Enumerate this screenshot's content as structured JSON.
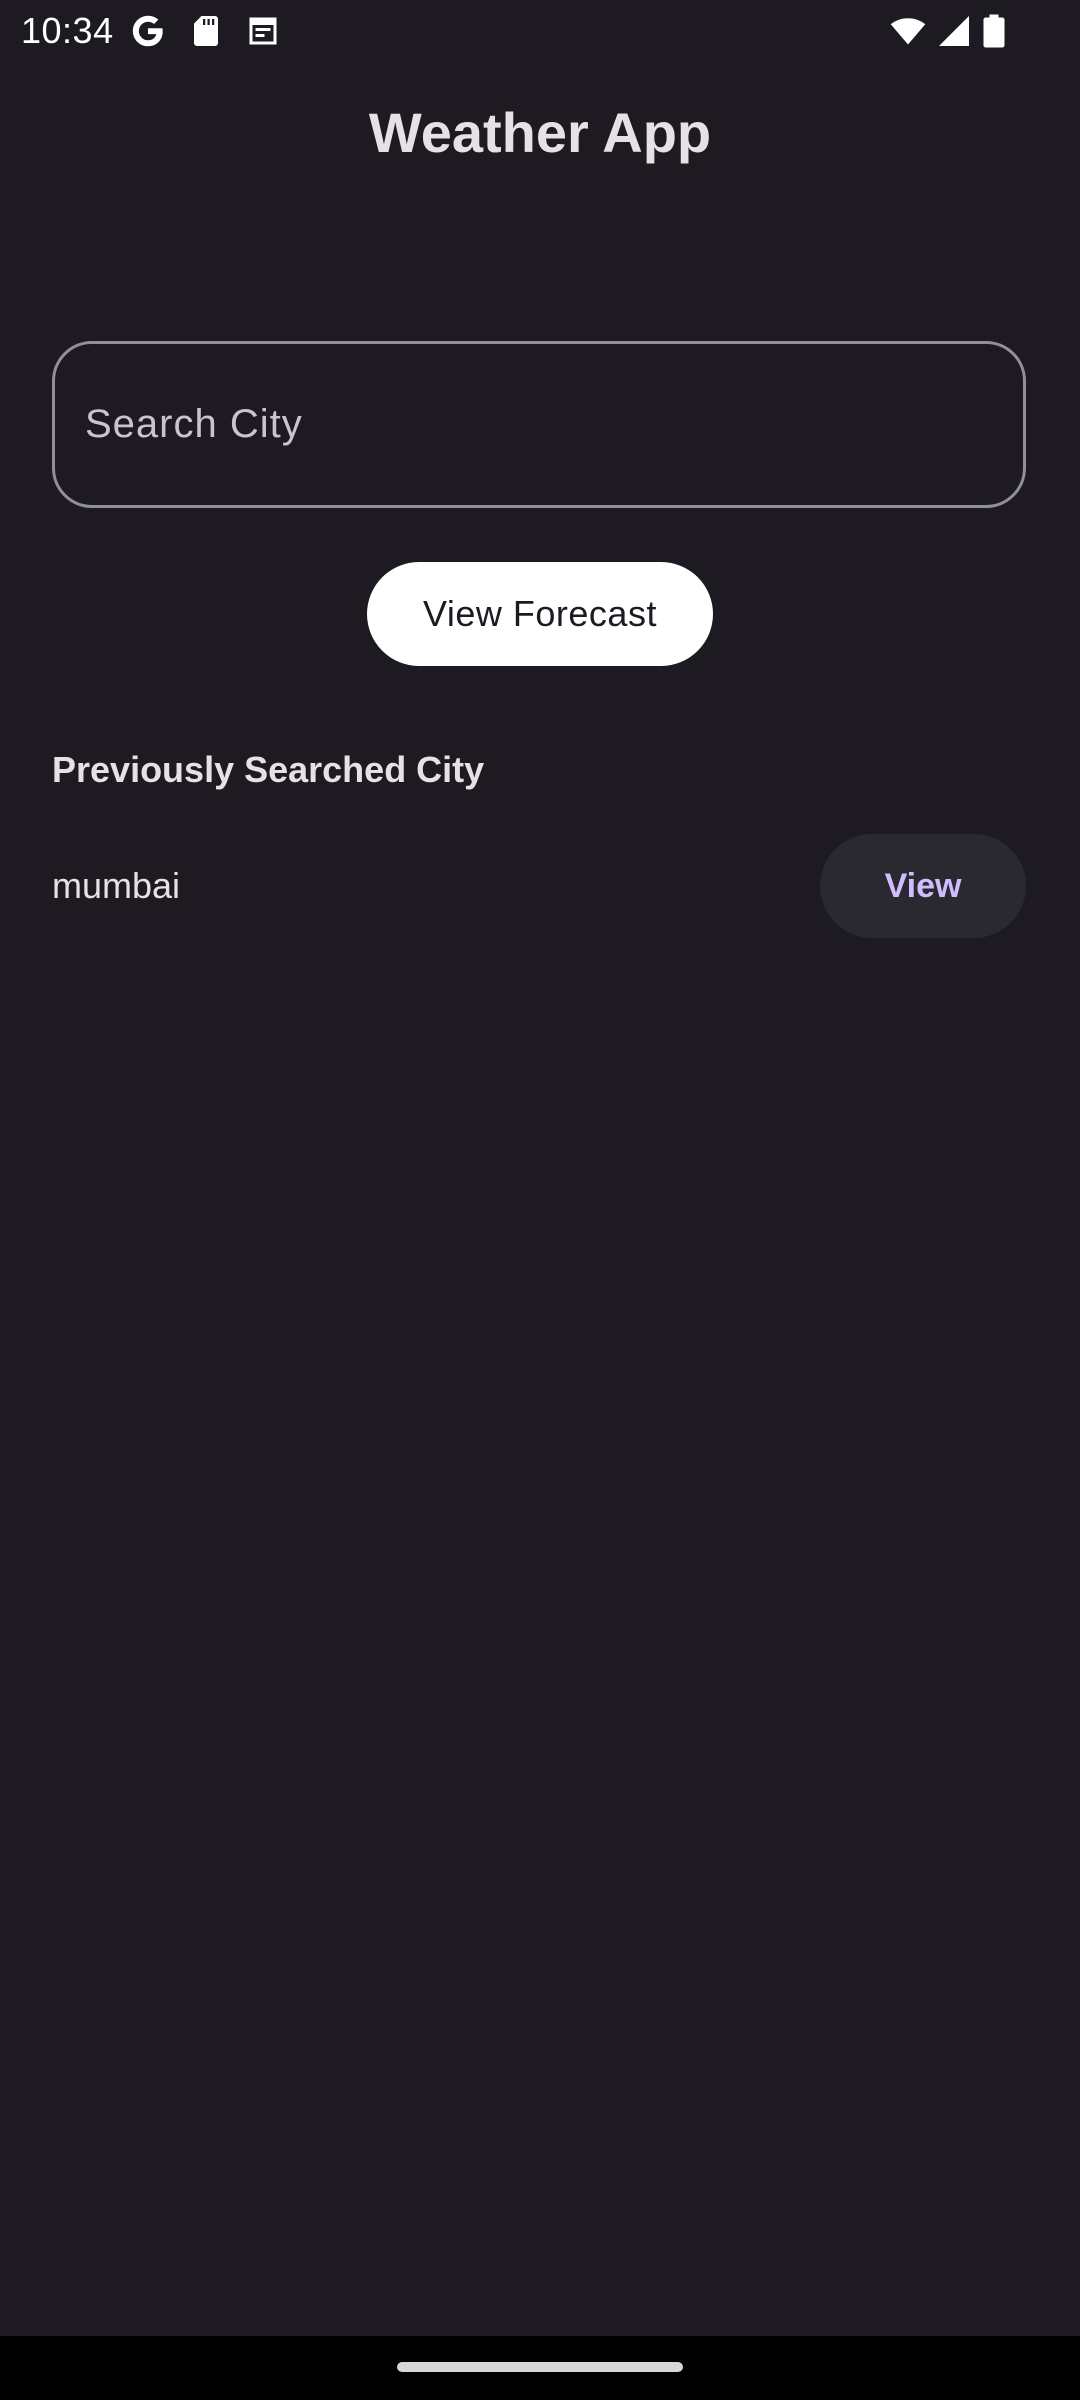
{
  "status_bar": {
    "time": "10:34",
    "icons": [
      "google-icon",
      "sd-card-icon",
      "calendar-icon",
      "wifi-icon",
      "cellular-signal-icon",
      "battery-icon"
    ]
  },
  "app": {
    "title": "Weather App"
  },
  "search": {
    "placeholder": "Search City",
    "value": ""
  },
  "forecast_button": {
    "label": "View Forecast"
  },
  "history": {
    "heading": "Previously Searched City",
    "items": [
      {
        "city": "mumbai",
        "action_label": "View"
      }
    ]
  },
  "colors": {
    "background": "#1d1b21",
    "text": "#e6e1e7",
    "accent": "#d0bcff",
    "outline": "#938f99",
    "button_bg": "#ffffff",
    "tonal_button_bg": "#2b2930"
  }
}
